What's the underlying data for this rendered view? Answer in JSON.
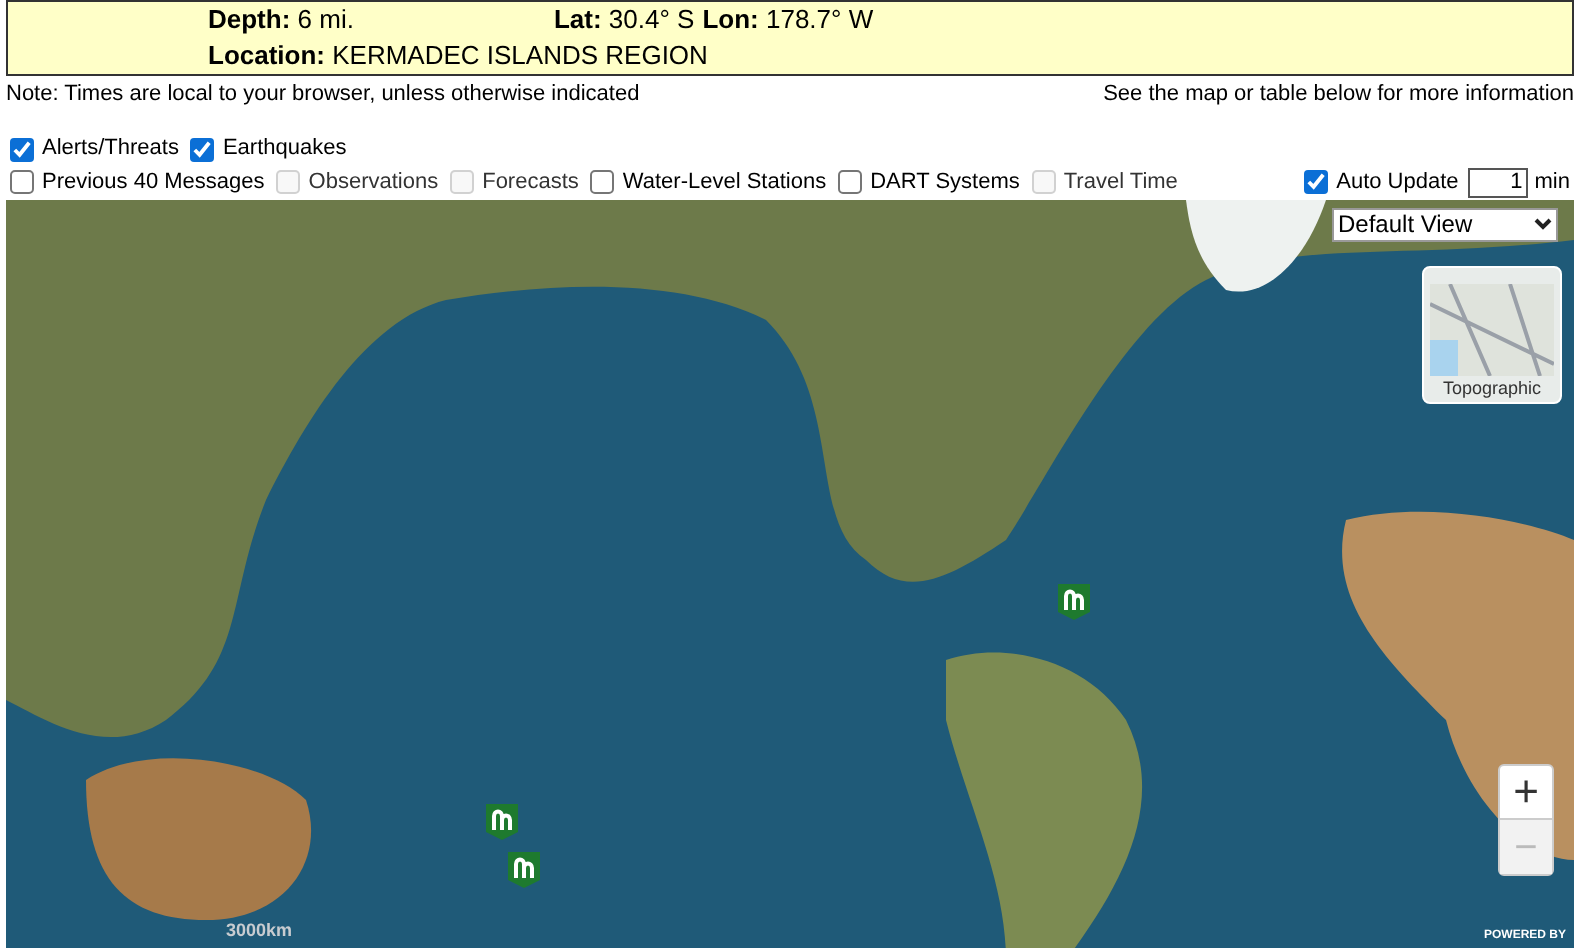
{
  "event_box": {
    "rows": [
      [
        {
          "label": "Depth:",
          "value": "6 mi."
        },
        {
          "label": "Lat:",
          "value": "30.4° S"
        },
        {
          "label": "Lon:",
          "value": "178.7° W"
        }
      ],
      [
        {
          "label": "Location:",
          "value": "KERMADEC ISLANDS REGION"
        }
      ]
    ]
  },
  "note": {
    "left": "Note: Times are local to your browser, unless otherwise indicated",
    "right": "See the map or table below for more information"
  },
  "layers_row_1": [
    {
      "label": "Alerts/Threats",
      "checked": true,
      "disabled": false
    },
    {
      "label": "Earthquakes",
      "checked": true,
      "disabled": false
    }
  ],
  "layers_row_2": [
    {
      "label": "Previous 40 Messages",
      "checked": false,
      "disabled": false
    },
    {
      "label": "Observations",
      "checked": false,
      "disabled": true
    },
    {
      "label": "Forecasts",
      "checked": false,
      "disabled": true
    },
    {
      "label": "Water-Level Stations",
      "checked": false,
      "disabled": false
    },
    {
      "label": "DART Systems",
      "checked": false,
      "disabled": false
    },
    {
      "label": "Travel Time",
      "checked": false,
      "disabled": true
    }
  ],
  "auto_update": {
    "label": "Auto Update",
    "checked": true,
    "value": "1",
    "unit": "min"
  },
  "map": {
    "view_select": "Default View",
    "basemap_label": "Topographic",
    "zoom_in": "+",
    "zoom_out": "−",
    "scale": "3000km",
    "attribution": "POWERED BY"
  }
}
